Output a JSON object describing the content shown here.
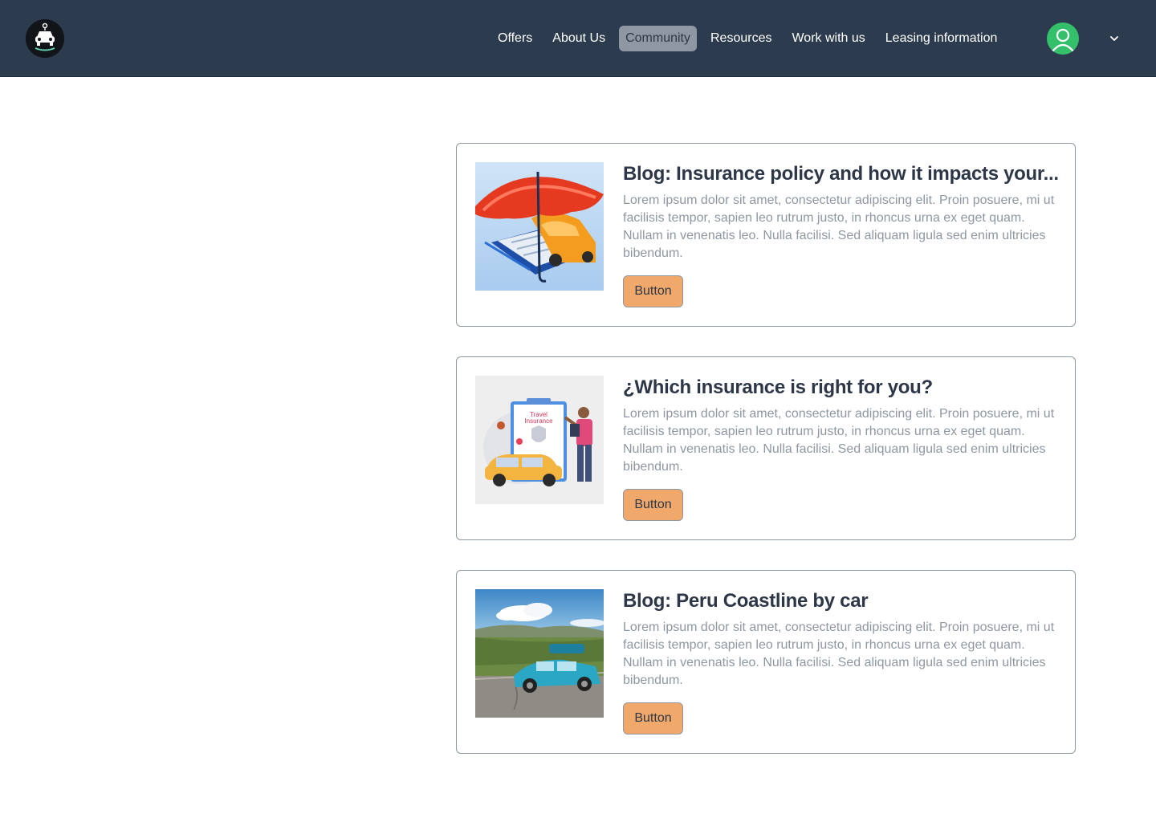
{
  "header": {
    "logo_icon": "car-logo-icon",
    "nav": [
      {
        "label": "Offers",
        "active": false
      },
      {
        "label": "About Us",
        "active": false
      },
      {
        "label": "Community",
        "active": true
      },
      {
        "label": "Resources",
        "active": false
      },
      {
        "label": "Work with us",
        "active": false
      },
      {
        "label": "Leasing information",
        "active": false
      }
    ],
    "avatar_icon": "user-avatar-icon",
    "menu_icon": "chevron-down-icon"
  },
  "cards": [
    {
      "title": "Blog: Insurance policy and how it impacts your...",
      "body": "Lorem ipsum dolor sit amet, consectetur adipiscing elit. Proin posuere, mi ut facilisis tempor, sapien leo rutrum justo, in rhoncus urna ex eget quam. Nullam in venenatis leo. Nulla facilisi. Sed aliquam ligula sed enim ultricies bibendum.",
      "button": "Button",
      "image": "umbrella-car-insurance-illustration"
    },
    {
      "title": "¿Which insurance is right for you?",
      "body": "Lorem ipsum dolor sit amet, consectetur adipiscing elit. Proin posuere, mi ut facilisis tempor, sapien leo rutrum justo, in rhoncus urna ex eget quam. Nullam in venenatis leo. Nulla facilisi. Sed aliquam ligula sed enim ultricies bibendum.",
      "button": "Button",
      "image": "travel-insurance-illustration",
      "image_text": "Travel Insurance"
    },
    {
      "title": "Blog: Peru Coastline by car",
      "body": "Lorem ipsum dolor sit amet, consectetur adipiscing elit. Proin posuere, mi ut facilisis tempor, sapien leo rutrum justo, in rhoncus urna ex eget quam. Nullam in venenatis leo. Nulla facilisi. Sed aliquam ligula sed enim ultricies bibendum.",
      "button": "Button",
      "image": "blue-car-road-photo"
    }
  ],
  "colors": {
    "navbar": "#2d3b4e",
    "active_nav": "#8e97a2",
    "button": "#f0a96a",
    "avatar": "#34c06a",
    "text_muted": "#8e97a2"
  }
}
